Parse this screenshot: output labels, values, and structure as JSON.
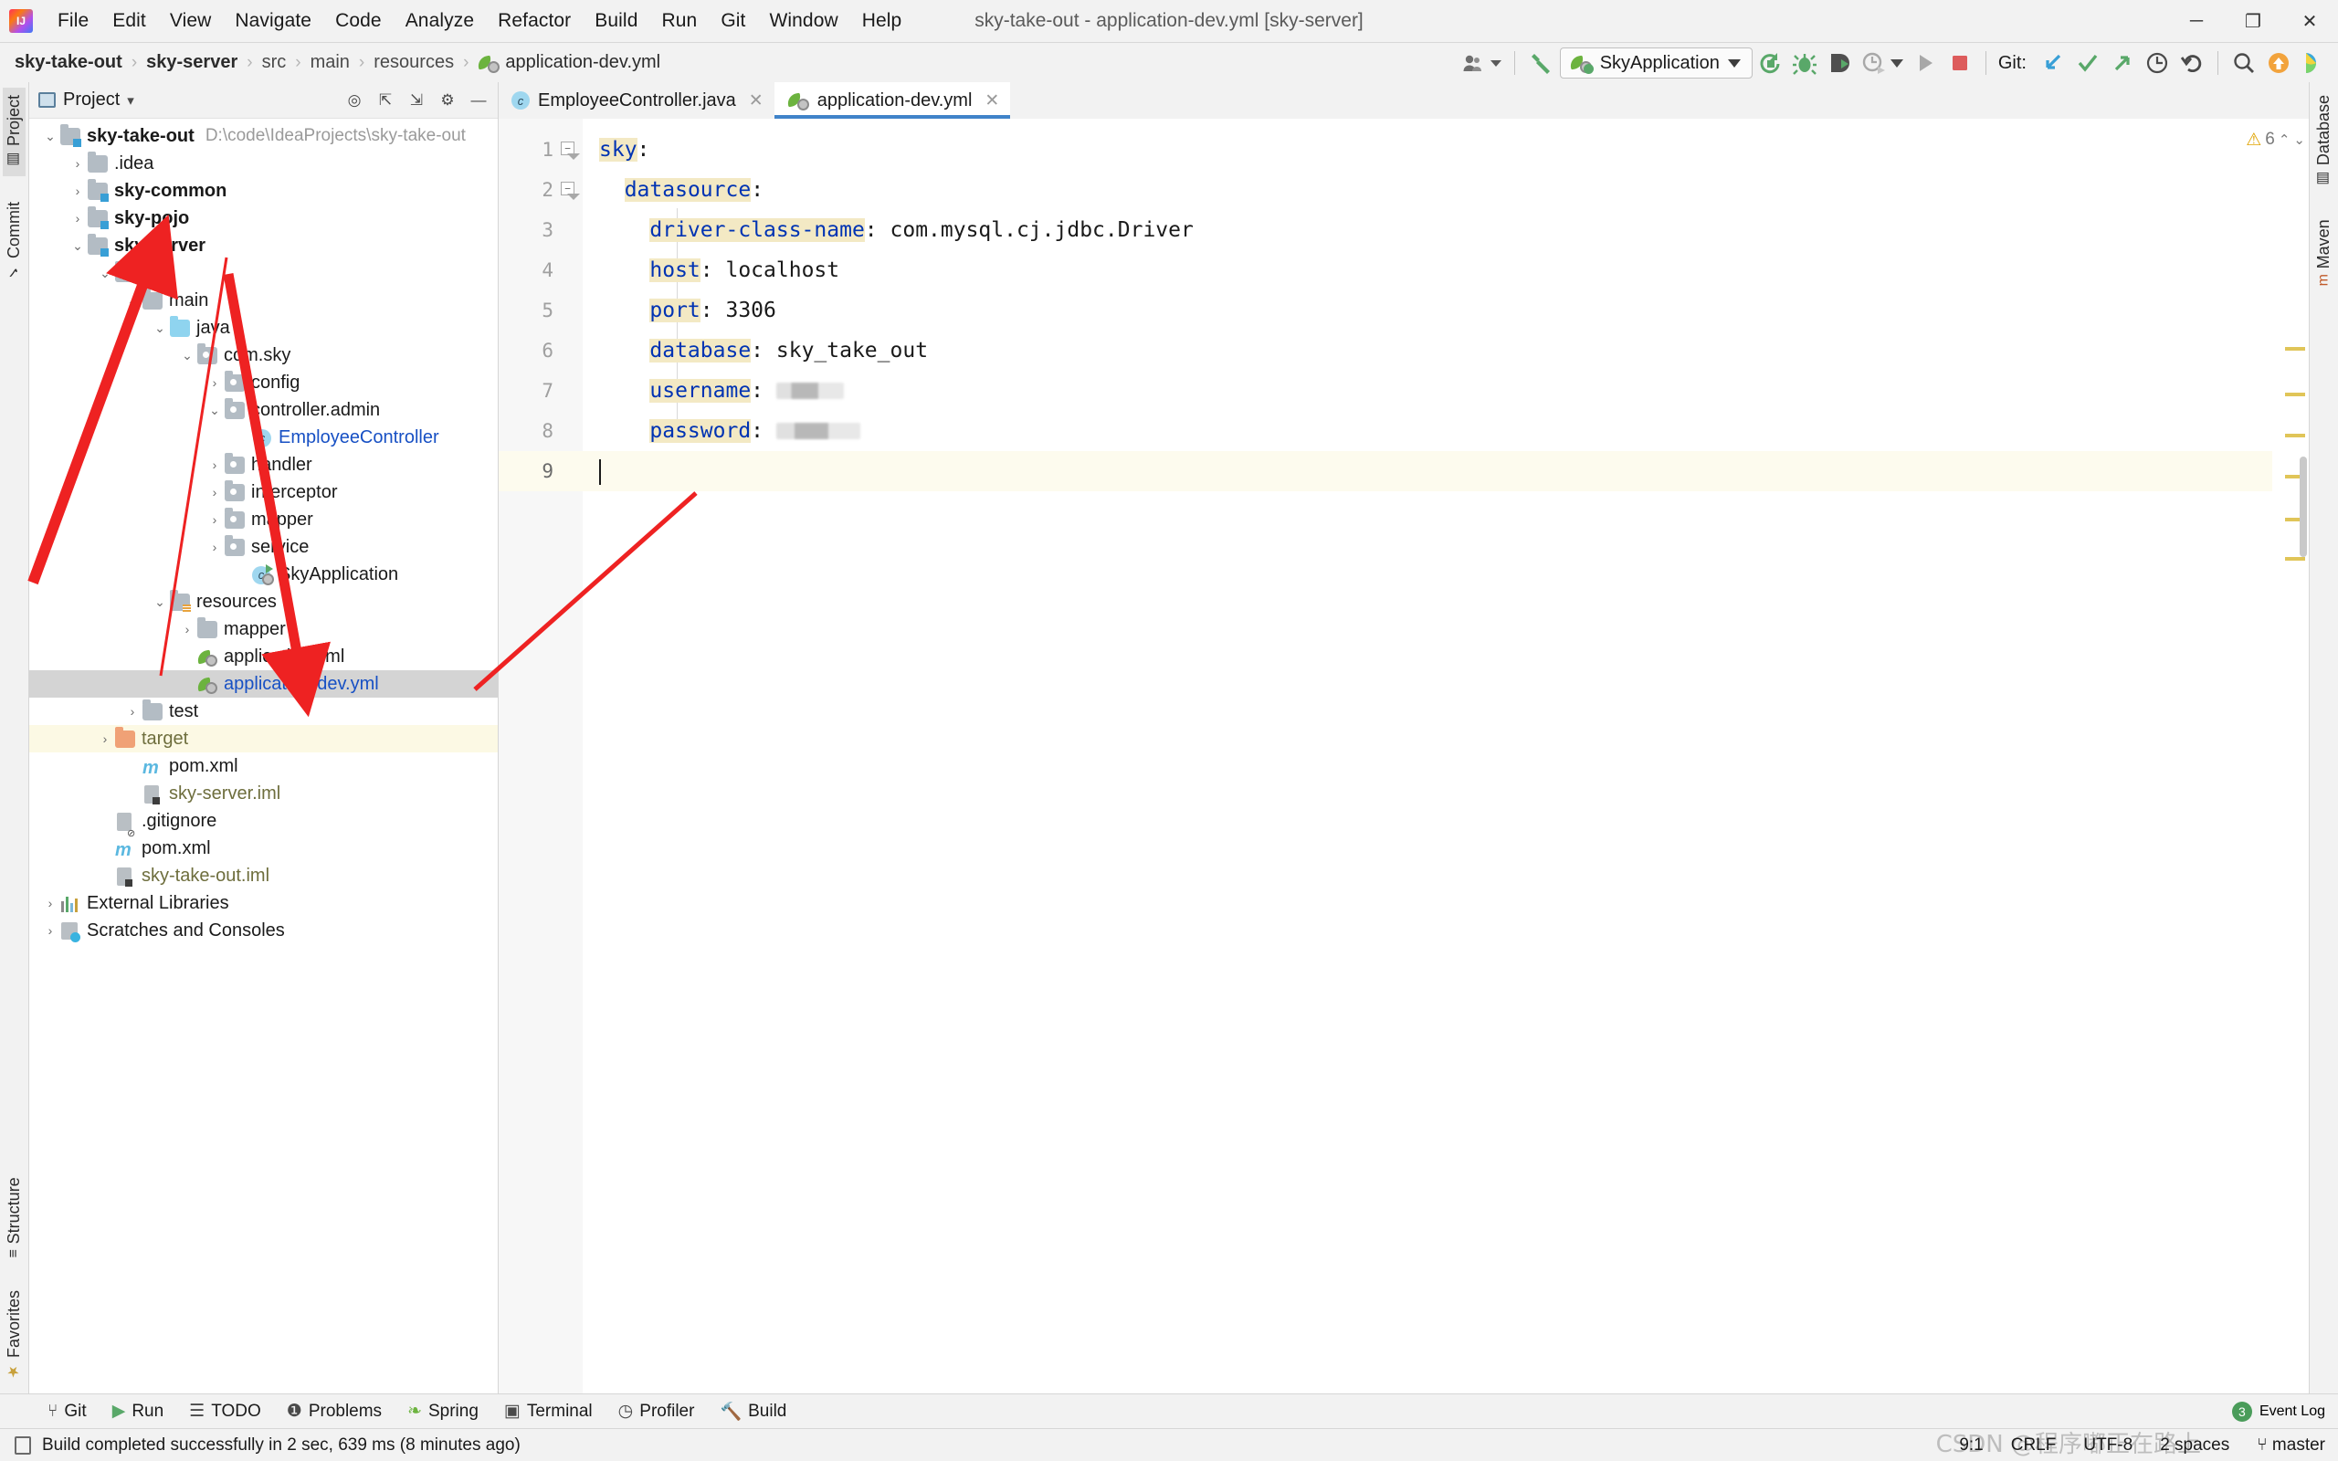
{
  "window": {
    "title": "sky-take-out - application-dev.yml [sky-server]",
    "minimize": "─",
    "maximize": "❐",
    "close": "✕"
  },
  "menubar": [
    {
      "label": "File"
    },
    {
      "label": "Edit"
    },
    {
      "label": "View"
    },
    {
      "label": "Navigate"
    },
    {
      "label": "Code"
    },
    {
      "label": "Analyze"
    },
    {
      "label": "Refactor"
    },
    {
      "label": "Build"
    },
    {
      "label": "Run"
    },
    {
      "label": "Git"
    },
    {
      "label": "Window"
    },
    {
      "label": "Help"
    }
  ],
  "breadcrumb": {
    "items": [
      "sky-take-out",
      "sky-server",
      "src",
      "main",
      "resources"
    ],
    "file": "application-dev.yml",
    "separator": "›"
  },
  "toolbar": {
    "run_config": "SkyApplication",
    "git_label": "Git:",
    "icons": [
      "user-avatar-icon",
      "build-hammer-icon",
      "run-config-dropdown",
      "rerun-icon",
      "debug-icon",
      "run-with-coverage-icon",
      "profiler-icon",
      "run-icon",
      "stop-icon",
      "git-update-icon",
      "git-commit-icon",
      "git-push-icon",
      "git-history-icon",
      "git-rollback-icon",
      "search-everywhere-icon",
      "notification-icon",
      "ide-feature-icon"
    ]
  },
  "left_rail": {
    "top": [
      {
        "label": "Project",
        "active": true
      },
      {
        "label": "Commit",
        "active": false
      }
    ],
    "bottom": [
      {
        "label": "Structure",
        "active": false
      },
      {
        "label": "Favorites",
        "active": false
      }
    ]
  },
  "right_rail": [
    {
      "label": "Database"
    },
    {
      "label": "Maven"
    }
  ],
  "project_panel": {
    "title": "Project",
    "dropdown": "▾",
    "header_icons": [
      "locate-icon",
      "collapse-all-icon",
      "expand-all-icon",
      "settings-gear-icon",
      "hide-icon"
    ],
    "tree": [
      {
        "depth": 0,
        "twisty": "v",
        "icon": "module-folder",
        "label": "sky-take-out",
        "bold": true,
        "hint": "D:\\code\\IdeaProjects\\sky-take-out"
      },
      {
        "depth": 1,
        "twisty": ">",
        "icon": "folder",
        "label": ".idea",
        "bold": false,
        "hint": ""
      },
      {
        "depth": 1,
        "twisty": ">",
        "icon": "module-folder",
        "label": "sky-common",
        "bold": true,
        "hint": ""
      },
      {
        "depth": 1,
        "twisty": ">",
        "icon": "module-folder",
        "label": "sky-pojo",
        "bold": true,
        "hint": ""
      },
      {
        "depth": 1,
        "twisty": "v",
        "icon": "module-folder",
        "label": "sky-server",
        "bold": true,
        "hint": ""
      },
      {
        "depth": 2,
        "twisty": "v",
        "icon": "folder",
        "label": "src",
        "bold": false,
        "hint": ""
      },
      {
        "depth": 3,
        "twisty": "v",
        "icon": "folder",
        "label": "main",
        "bold": false,
        "hint": ""
      },
      {
        "depth": 4,
        "twisty": "v",
        "icon": "source-folder",
        "label": "java",
        "bold": false,
        "hint": ""
      },
      {
        "depth": 5,
        "twisty": "v",
        "icon": "package",
        "label": "com.sky",
        "bold": false,
        "hint": ""
      },
      {
        "depth": 6,
        "twisty": ">",
        "icon": "package",
        "label": "config",
        "bold": false,
        "hint": ""
      },
      {
        "depth": 6,
        "twisty": "v",
        "icon": "package",
        "label": "controller.admin",
        "bold": false,
        "hint": ""
      },
      {
        "depth": 7,
        "twisty": "",
        "icon": "java-class",
        "label": "EmployeeController",
        "bold": false,
        "hint": "",
        "color": "blue"
      },
      {
        "depth": 6,
        "twisty": ">",
        "icon": "package",
        "label": "handler",
        "bold": false,
        "hint": ""
      },
      {
        "depth": 6,
        "twisty": ">",
        "icon": "package",
        "label": "interceptor",
        "bold": false,
        "hint": ""
      },
      {
        "depth": 6,
        "twisty": ">",
        "icon": "package",
        "label": "mapper",
        "bold": false,
        "hint": ""
      },
      {
        "depth": 6,
        "twisty": ">",
        "icon": "package",
        "label": "service",
        "bold": false,
        "hint": ""
      },
      {
        "depth": 7,
        "twisty": "",
        "icon": "spring-boot-class",
        "label": "SkyApplication",
        "bold": false,
        "hint": ""
      },
      {
        "depth": 4,
        "twisty": "v",
        "icon": "resource-folder",
        "label": "resources",
        "bold": false,
        "hint": ""
      },
      {
        "depth": 5,
        "twisty": ">",
        "icon": "folder",
        "label": "mapper",
        "bold": false,
        "hint": ""
      },
      {
        "depth": 5,
        "twisty": "",
        "icon": "spring-yml",
        "label": "application.yml",
        "bold": false,
        "hint": ""
      },
      {
        "depth": 5,
        "twisty": "",
        "icon": "spring-yml",
        "label": "application-dev.yml",
        "bold": false,
        "hint": "",
        "color": "blue",
        "selected": true
      },
      {
        "depth": 3,
        "twisty": ">",
        "icon": "folder",
        "label": "test",
        "bold": false,
        "hint": ""
      },
      {
        "depth": 2,
        "twisty": ">",
        "icon": "target-folder",
        "label": "target",
        "bold": false,
        "hint": "",
        "color": "olive",
        "highlight": true
      },
      {
        "depth": 3,
        "twisty": "",
        "icon": "maven-file",
        "label": "pom.xml",
        "bold": false,
        "hint": ""
      },
      {
        "depth": 3,
        "twisty": "",
        "icon": "iml-file",
        "label": "sky-server.iml",
        "bold": false,
        "hint": "",
        "color": "olive"
      },
      {
        "depth": 2,
        "twisty": "",
        "icon": "gitignore-file",
        "label": ".gitignore",
        "bold": false,
        "hint": ""
      },
      {
        "depth": 2,
        "twisty": "",
        "icon": "maven-file",
        "label": "pom.xml",
        "bold": false,
        "hint": ""
      },
      {
        "depth": 2,
        "twisty": "",
        "icon": "iml-file",
        "label": "sky-take-out.iml",
        "bold": false,
        "hint": "",
        "color": "olive"
      },
      {
        "depth": 0,
        "twisty": ">",
        "icon": "external-libraries",
        "label": "External Libraries",
        "bold": false,
        "hint": ""
      },
      {
        "depth": 0,
        "twisty": ">",
        "icon": "scratches",
        "label": "Scratches and Consoles",
        "bold": false,
        "hint": ""
      }
    ]
  },
  "editor": {
    "tabs": [
      {
        "label": "EmployeeController.java",
        "icon": "java-class-icon",
        "active": false,
        "close": "✕"
      },
      {
        "label": "application-dev.yml",
        "icon": "spring-yml-icon",
        "active": true,
        "close": "✕"
      }
    ],
    "line_numbers": [
      "1",
      "2",
      "3",
      "4",
      "5",
      "6",
      "7",
      "8",
      "9"
    ],
    "lines": [
      {
        "n": 1,
        "indent": 0,
        "key": "sky",
        "colon": ":",
        "value": "",
        "fold": "minus"
      },
      {
        "n": 2,
        "indent": 1,
        "key": "datasource",
        "colon": ":",
        "value": "",
        "fold": "minus"
      },
      {
        "n": 3,
        "indent": 2,
        "key": "driver-class-name",
        "colon": ":",
        "value": " com.mysql.cj.jdbc.Driver",
        "fold": ""
      },
      {
        "n": 4,
        "indent": 2,
        "key": "host",
        "colon": ":",
        "value": " localhost",
        "fold": ""
      },
      {
        "n": 5,
        "indent": 2,
        "key": "port",
        "colon": ":",
        "value": " 3306",
        "fold": ""
      },
      {
        "n": 6,
        "indent": 2,
        "key": "database",
        "colon": ":",
        "value": " sky_take_out",
        "fold": ""
      },
      {
        "n": 7,
        "indent": 2,
        "key": "username",
        "colon": ":",
        "value": "REDACTED",
        "fold": ""
      },
      {
        "n": 8,
        "indent": 2,
        "key": "password",
        "colon": ":",
        "value": "REDACTED",
        "fold": ""
      },
      {
        "n": 9,
        "indent": 0,
        "key": "",
        "colon": "",
        "value": "",
        "fold": ""
      }
    ],
    "warning_count": "6",
    "warning_icon": "warning-triangle-icon"
  },
  "tool_windows": [
    {
      "label": "Git",
      "icon": "git-branch-icon"
    },
    {
      "label": "Run",
      "icon": "run-icon"
    },
    {
      "label": "TODO",
      "icon": "todo-list-icon"
    },
    {
      "label": "Problems",
      "icon": "problems-icon"
    },
    {
      "label": "Spring",
      "icon": "spring-leaf-icon"
    },
    {
      "label": "Terminal",
      "icon": "terminal-icon"
    },
    {
      "label": "Profiler",
      "icon": "profiler-icon"
    },
    {
      "label": "Build",
      "icon": "build-hammer-icon"
    }
  ],
  "event_log": {
    "label": "Event Log",
    "count": "3"
  },
  "statusbar": {
    "message": "Build completed successfully in 2 sec, 639 ms (8 minutes ago)",
    "caret_position": "9:1",
    "line_separator": "CRLF",
    "encoding": "UTF-8",
    "indent": "2 spaces",
    "branch": "master",
    "watermark": "CSDN @程序嘟正在路上"
  },
  "colors": {
    "accent_blue": "#4083c9",
    "key_blue": "#0033b3",
    "highlight_yellow": "#f3e9c4",
    "selection_grey": "#d4d4d4",
    "green": "#59a869",
    "annotation_red": "#ee2222"
  }
}
